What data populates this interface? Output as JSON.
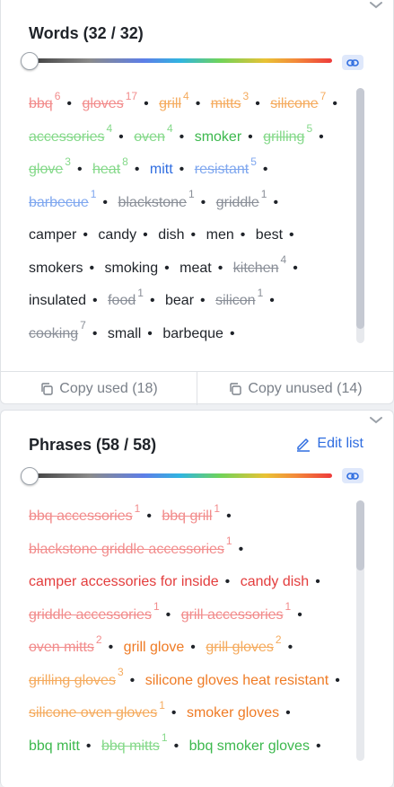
{
  "words_panel": {
    "title": "Words (32 / 32)",
    "copy_used": "Copy used (18)",
    "copy_unused": "Copy unused (14)",
    "items": [
      {
        "text": "bbq",
        "count": "6",
        "color": "red",
        "used": true
      },
      {
        "text": "gloves",
        "count": "17",
        "color": "red",
        "used": true
      },
      {
        "text": "grill",
        "count": "4",
        "color": "org",
        "used": true
      },
      {
        "text": "mitts",
        "count": "3",
        "color": "org",
        "used": true
      },
      {
        "text": "silicone",
        "count": "7",
        "color": "org",
        "used": true
      },
      {
        "text": "accessories",
        "count": "4",
        "color": "grn",
        "used": true
      },
      {
        "text": "oven",
        "count": "4",
        "color": "grn",
        "used": true
      },
      {
        "text": "smoker",
        "count": "",
        "color": "grn2",
        "used": false
      },
      {
        "text": "grilling",
        "count": "5",
        "color": "grn",
        "used": true
      },
      {
        "text": "glove",
        "count": "3",
        "color": "grn",
        "used": true
      },
      {
        "text": "heat",
        "count": "8",
        "color": "grn",
        "used": true
      },
      {
        "text": "mitt",
        "count": "",
        "color": "blu2",
        "used": false
      },
      {
        "text": "resistant",
        "count": "5",
        "color": "blu",
        "used": true
      },
      {
        "text": "barbecue",
        "count": "1",
        "color": "blu",
        "used": true
      },
      {
        "text": "blackstone",
        "count": "1",
        "color": "gry",
        "used": true
      },
      {
        "text": "griddle",
        "count": "1",
        "color": "gry",
        "used": true
      },
      {
        "text": "camper",
        "count": "",
        "color": "dark",
        "used": false
      },
      {
        "text": "candy",
        "count": "",
        "color": "dark",
        "used": false
      },
      {
        "text": "dish",
        "count": "",
        "color": "dark",
        "used": false
      },
      {
        "text": "men",
        "count": "",
        "color": "dark",
        "used": false
      },
      {
        "text": "best",
        "count": "",
        "color": "dark",
        "used": false
      },
      {
        "text": "smokers",
        "count": "",
        "color": "dark",
        "used": false
      },
      {
        "text": "smoking",
        "count": "",
        "color": "dark",
        "used": false
      },
      {
        "text": "meat",
        "count": "",
        "color": "dark",
        "used": false
      },
      {
        "text": "kitchen",
        "count": "4",
        "color": "gry",
        "used": true
      },
      {
        "text": "insulated",
        "count": "",
        "color": "dark",
        "used": false
      },
      {
        "text": "food",
        "count": "1",
        "color": "gry",
        "used": true
      },
      {
        "text": "bear",
        "count": "",
        "color": "dark",
        "used": false
      },
      {
        "text": "silicon",
        "count": "1",
        "color": "gry",
        "used": true
      },
      {
        "text": "cooking",
        "count": "7",
        "color": "gry",
        "used": true
      },
      {
        "text": "small",
        "count": "",
        "color": "dark",
        "used": false
      },
      {
        "text": "barbeque",
        "count": "",
        "color": "dark",
        "used": false
      }
    ]
  },
  "phrases_panel": {
    "title": "Phrases (58 / 58)",
    "edit_label": "Edit list",
    "items": [
      {
        "text": "bbq accessories",
        "count": "1",
        "color": "red",
        "used": true
      },
      {
        "text": "bbq grill",
        "count": "1",
        "color": "red",
        "used": true
      },
      {
        "text": "blackstone griddle accessories",
        "count": "1",
        "color": "red",
        "used": true
      },
      {
        "text": "camper accessories for inside",
        "count": "",
        "color": "red2",
        "used": false
      },
      {
        "text": "candy dish",
        "count": "",
        "color": "red2",
        "used": false
      },
      {
        "text": "griddle accessories",
        "count": "1",
        "color": "red",
        "used": true
      },
      {
        "text": "grill accessories",
        "count": "1",
        "color": "red",
        "used": true
      },
      {
        "text": "oven mitts",
        "count": "2",
        "color": "red",
        "used": true
      },
      {
        "text": "grill glove",
        "count": "",
        "color": "org2",
        "used": false
      },
      {
        "text": "grill gloves",
        "count": "2",
        "color": "org",
        "used": true
      },
      {
        "text": "grilling gloves",
        "count": "3",
        "color": "org",
        "used": true
      },
      {
        "text": "silicone gloves heat resistant",
        "count": "",
        "color": "org2",
        "used": false
      },
      {
        "text": "silicone oven gloves",
        "count": "1",
        "color": "org",
        "used": true
      },
      {
        "text": "smoker gloves",
        "count": "",
        "color": "org2",
        "used": false
      },
      {
        "text": "bbq mitt",
        "count": "",
        "color": "grn2",
        "used": false
      },
      {
        "text": "bbq mitts",
        "count": "1",
        "color": "grn",
        "used": true
      },
      {
        "text": "bbq smoker gloves",
        "count": "",
        "color": "grn2",
        "used": false
      }
    ]
  }
}
